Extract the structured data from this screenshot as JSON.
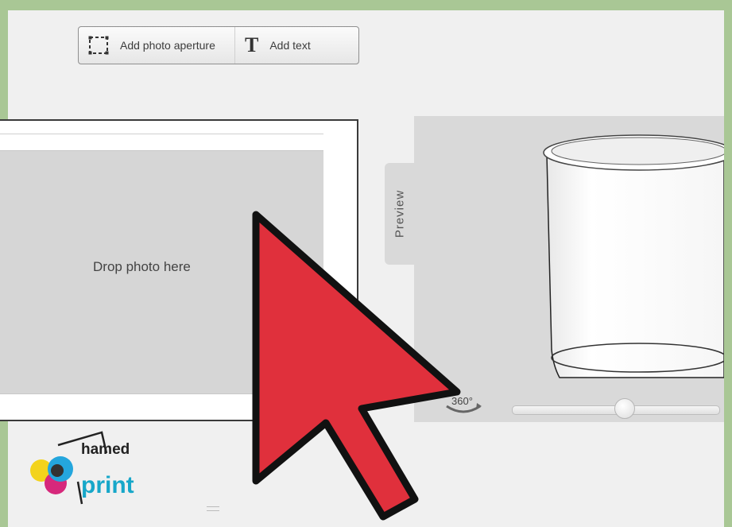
{
  "toolbar": {
    "add_photo_aperture_label": "Add photo aperture",
    "add_photo_aperture_icon": "dashed-frame-icon",
    "add_text_label": "Add text",
    "add_text_glyph": "T"
  },
  "editor": {
    "drop_placeholder": "Drop photo here"
  },
  "preview": {
    "tab_label": "Preview",
    "rotate_label": "360°",
    "rotation_slider_value": 0.5
  },
  "logo": {
    "line1": "hamed",
    "line2": "print"
  },
  "cursor": {
    "icon": "arrow-cursor-icon",
    "color": "#e0303c"
  },
  "colors": {
    "frame_border": "#a9c795",
    "canvas_bg": "#f0f0f0",
    "preview_bg": "#d9d9d9"
  }
}
